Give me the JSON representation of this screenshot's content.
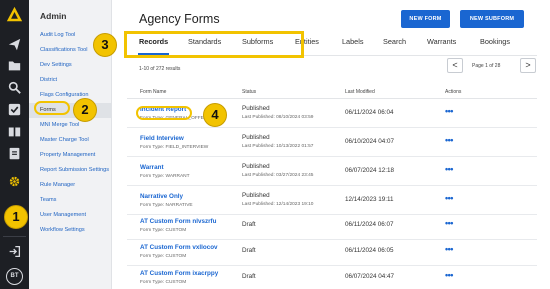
{
  "rail": {
    "icons": [
      "logo-icon",
      "send-icon",
      "folder-icon",
      "search-icon",
      "checkbox-icon",
      "book-icon",
      "document-icon",
      "gear-icon",
      "logout-icon"
    ],
    "avatar": "BT",
    "gear_color": "#f2c300"
  },
  "sidebar": {
    "title": "Admin",
    "items": [
      {
        "label": "Audit Log Tool"
      },
      {
        "label": "Classifications Tool"
      },
      {
        "label": "Dev Settings"
      },
      {
        "label": "District"
      },
      {
        "label": "Flags Configuration"
      },
      {
        "label": "Forms"
      },
      {
        "label": "MNI Merge Tool"
      },
      {
        "label": "Master Charge Tool"
      },
      {
        "label": "Property Management"
      },
      {
        "label": "Report Submission Settings"
      },
      {
        "label": "Rule Manager"
      },
      {
        "label": "Teams"
      },
      {
        "label": "User Management"
      },
      {
        "label": "Workflow Settings"
      }
    ],
    "active_index": 5
  },
  "main": {
    "title": "Agency Forms",
    "buttons": {
      "new_form": "NEW FORM",
      "new_subform": "NEW SUBFORM"
    },
    "tabs": [
      {
        "label": "Records"
      },
      {
        "label": "Standards"
      },
      {
        "label": "Subforms"
      },
      {
        "label": "Entities"
      },
      {
        "label": "Labels"
      },
      {
        "label": "Search"
      },
      {
        "label": "Warrants"
      },
      {
        "label": "Bookings"
      }
    ],
    "active_tab": 0,
    "result_count": "1-10 of 272 results",
    "pager": {
      "prev": "<",
      "next": ">",
      "text": "Page 1 of 28"
    },
    "columns": {
      "name": "Form Name",
      "status": "Status",
      "modified": "Last Modified",
      "actions": "Actions"
    },
    "rows": [
      {
        "name": "Incident Report",
        "type": "Form Type: GENERAL_OFFENSE",
        "status": "Published",
        "last_published": "Last Published: 08/10/2024 03:59",
        "modified": "06/11/2024 06:04",
        "actions": "•••"
      },
      {
        "name": "Field Interview",
        "type": "Form Type: FIELD_INTERVIEW",
        "status": "Published",
        "last_published": "Last Published: 10/13/2022 01:57",
        "modified": "06/10/2024 04:07",
        "actions": "•••"
      },
      {
        "name": "Warrant",
        "type": "Form Type: WARRANT",
        "status": "Published",
        "last_published": "Last Published: 03/27/2024 23:45",
        "modified": "06/07/2024 12:18",
        "actions": "•••"
      },
      {
        "name": "Narrative Only",
        "type": "Form Type: NARRATIVE",
        "status": "Published",
        "last_published": "Last Published: 12/14/2023 19:10",
        "modified": "12/14/2023 19:11",
        "actions": "•••"
      },
      {
        "name": "AT Custom Form nlvszrfu",
        "type": "Form Type: CUSTOM",
        "status": "Draft",
        "last_published": "",
        "modified": "06/11/2024 06:07",
        "actions": "•••"
      },
      {
        "name": "AT Custom Form vxllocov",
        "type": "Form Type: CUSTOM",
        "status": "Draft",
        "last_published": "",
        "modified": "06/11/2024 06:05",
        "actions": "•••"
      },
      {
        "name": "AT Custom Form ixacrppy",
        "type": "Form Type: CUSTOM",
        "status": "Draft",
        "last_published": "",
        "modified": "06/07/2024 04:47",
        "actions": "•••"
      }
    ]
  },
  "annotations": {
    "color": "#f2c300",
    "badges": [
      "1",
      "2",
      "3",
      "4"
    ]
  }
}
